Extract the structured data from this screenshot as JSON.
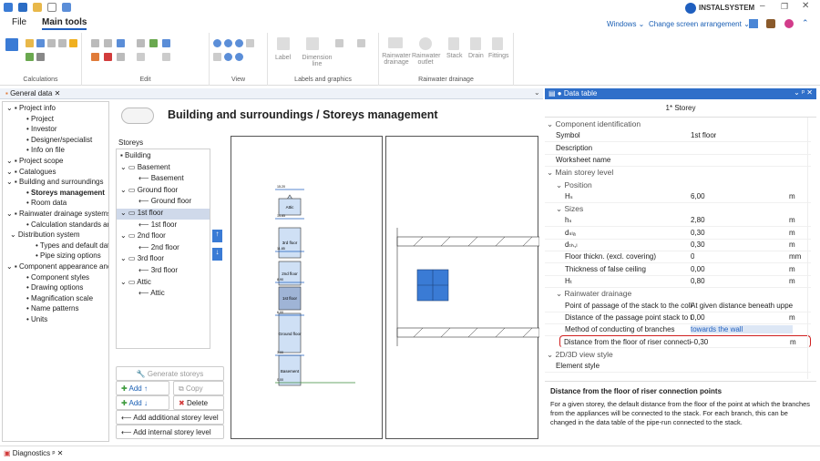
{
  "app": {
    "brand": "INSTALSYSTEM",
    "windows_btn": "Windows",
    "arrangement_btn": "Change screen arrangement"
  },
  "menu": {
    "file": "File",
    "main_tools": "Main tools"
  },
  "ribbon": {
    "groups": [
      "Calculations",
      "Edit",
      "View",
      "Labels and graphics",
      "Rainwater drainage"
    ],
    "labels": [
      "Label",
      "Dimension line",
      "Rainwater drainage",
      "Rainwater outlet",
      "Stack",
      "Drain",
      "Fittings"
    ]
  },
  "general_tab": "General data",
  "tree": [
    {
      "t": "Project info",
      "lvl": 0
    },
    {
      "t": "Project",
      "lvl": 2
    },
    {
      "t": "Investor",
      "lvl": 2
    },
    {
      "t": "Designer/specialist",
      "lvl": 2
    },
    {
      "t": "Info on file",
      "lvl": 2
    },
    {
      "t": "Project scope",
      "lvl": 0
    },
    {
      "t": "Catalogues",
      "lvl": 0
    },
    {
      "t": "Building and surroundings",
      "lvl": 0
    },
    {
      "t": "Storeys management",
      "lvl": 2
    },
    {
      "t": "Room data",
      "lvl": 2
    },
    {
      "t": "Rainwater drainage systems c",
      "lvl": 0
    },
    {
      "t": "Calculation standards and c",
      "lvl": 2
    },
    {
      "t": "Distribution system",
      "lvl": 1
    },
    {
      "t": "Types and default data",
      "lvl": 3
    },
    {
      "t": "Pipe sizing options",
      "lvl": 3
    },
    {
      "t": "Component appearance and",
      "lvl": 0
    },
    {
      "t": "Component styles",
      "lvl": 2
    },
    {
      "t": "Drawing options",
      "lvl": 2
    },
    {
      "t": "Magnification scale",
      "lvl": 2
    },
    {
      "t": "Name patterns",
      "lvl": 2
    },
    {
      "t": "Units",
      "lvl": 2
    }
  ],
  "page_title": "Building and surroundings / Storeys management",
  "storeys_label": "Storeys",
  "storeys": [
    {
      "t": "Building",
      "lvl": 0
    },
    {
      "t": "Basement",
      "lvl": 1
    },
    {
      "t": "Basement",
      "lvl": 2
    },
    {
      "t": "Ground floor",
      "lvl": 1
    },
    {
      "t": "Ground floor",
      "lvl": 2
    },
    {
      "t": "1st floor",
      "lvl": 1
    },
    {
      "t": "1st floor",
      "lvl": 2
    },
    {
      "t": "2nd floor",
      "lvl": 1
    },
    {
      "t": "2nd floor",
      "lvl": 2
    },
    {
      "t": "3rd floor",
      "lvl": 1
    },
    {
      "t": "3rd floor",
      "lvl": 2
    },
    {
      "t": "Attic",
      "lvl": 1
    },
    {
      "t": "Attic",
      "lvl": 2
    }
  ],
  "buttons": {
    "generate": "Generate storeys",
    "add1": "Add",
    "add2": "Add",
    "copy": "Copy",
    "delete": "Delete",
    "add_additional": "Add additional storey level",
    "add_internal": "Add internal storey level"
  },
  "section_floors": [
    "Attic",
    "3rd floor",
    "2nd floor",
    "1st floor",
    "Ground floor",
    "Basement"
  ],
  "levels": [
    "15.20",
    "14.85",
    "11.85",
    "8.90",
    "6.00",
    "3.00",
    "0.00",
    "-3.00"
  ],
  "data_table": {
    "title": "Data table",
    "storey": "1* Storey",
    "rows": [
      {
        "k": "Component identification",
        "v": "",
        "type": "sec",
        "lvl": 0
      },
      {
        "k": "Symbol",
        "v": "1st floor",
        "type": "row",
        "lvl": 1
      },
      {
        "k": "Description",
        "v": "",
        "type": "row",
        "lvl": 1
      },
      {
        "k": "Worksheet name",
        "v": "",
        "type": "row",
        "lvl": 1
      },
      {
        "k": "Main storey level",
        "v": "",
        "type": "sec",
        "lvl": 0
      },
      {
        "k": "Position",
        "v": "",
        "type": "sec",
        "lvl": 1
      },
      {
        "k": "Hₛ",
        "v": "6,00",
        "u": "m",
        "type": "row",
        "lvl": 2
      },
      {
        "k": "Sizes",
        "v": "",
        "type": "sec",
        "lvl": 1
      },
      {
        "k": "hₛ",
        "v": "2,80",
        "u": "m",
        "type": "row",
        "lvl": 2
      },
      {
        "k": "dₛₗₐ",
        "v": "0,30",
        "u": "m",
        "type": "row",
        "lvl": 2
      },
      {
        "k": "dₜₕ,ₗ",
        "v": "0,30",
        "u": "m",
        "type": "row",
        "lvl": 2
      },
      {
        "k": "Floor thickn. (excl. covering)",
        "v": "0",
        "u": "mm",
        "type": "row",
        "lvl": 2
      },
      {
        "k": "Thickness of false ceiling",
        "v": "0,00",
        "u": "m",
        "type": "row",
        "lvl": 2
      },
      {
        "k": "Hₜ",
        "v": "0,80",
        "u": "m",
        "type": "row",
        "lvl": 2
      },
      {
        "k": "Rainwater drainage",
        "v": "",
        "type": "sec",
        "lvl": 1
      },
      {
        "k": "Point of passage of the stack to the collector",
        "v": "At given distance beneath upper sla",
        "type": "row",
        "lvl": 2
      },
      {
        "k": "Distance of the passage point stack to the co",
        "v": "0,00",
        "u": "m",
        "type": "row",
        "lvl": 2
      },
      {
        "k": "Method of conducting of branches",
        "v": "towards the wall",
        "type": "row",
        "lvl": 2
      },
      {
        "k": "Distance from the floor of riser connection p",
        "v": "-0,30",
        "u": "m",
        "type": "row",
        "lvl": 2,
        "focus": true
      },
      {
        "k": "2D/3D view style",
        "v": "",
        "type": "sec",
        "lvl": 0
      },
      {
        "k": "Element style",
        "v": "",
        "type": "row",
        "lvl": 1
      }
    ],
    "help_title": "Distance from the floor of riser connection points",
    "help_text": "For a given storey, the default distance from the floor of the point at which the branches from the appliances will be connected to the stack. For each branch, this can be changed in the data table of the pipe-run connected to the stack."
  },
  "diagnostics": "Diagnostics",
  "colors": {
    "accent": "#1f5fbf",
    "selection": "#cfd9ea",
    "focus_border": "#d02020",
    "floor_fill": "#cfe0f5"
  }
}
